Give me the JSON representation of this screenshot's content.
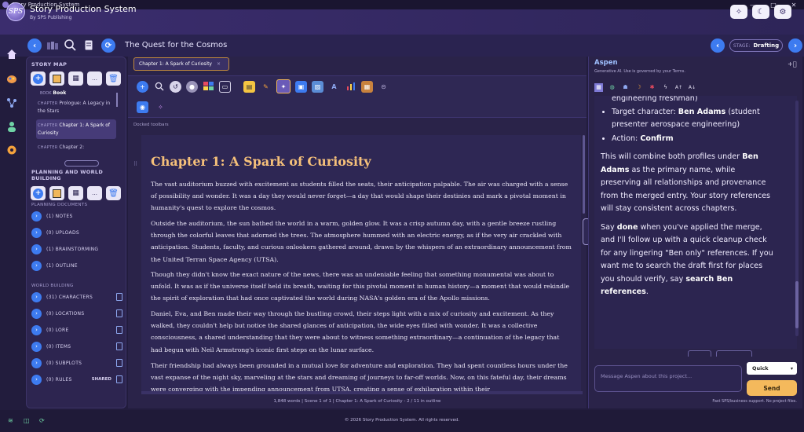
{
  "window": {
    "title": "Story Production System",
    "controls": [
      "—",
      "□",
      "✕"
    ]
  },
  "header": {
    "logo_text": "SPS",
    "title": "Story Production System",
    "subtitle": "By SPS Publishing"
  },
  "toolbar": {
    "story_title": "The Quest for the Cosmos",
    "stage_label": "STAGE:",
    "stage_value": "Drafting"
  },
  "sidebar": {
    "story_map_title": "STORY MAP",
    "book_kind": "BOOK",
    "book_name": "Book",
    "chapters": [
      {
        "kind": "CHAPTER",
        "name": "Prologue: A Legacy in the Stars"
      },
      {
        "kind": "CHAPTER",
        "name": "Chapter 1: A Spark of Curiosity"
      },
      {
        "kind": "CHAPTER",
        "name": "Chapter 2:"
      }
    ],
    "planning_title": "PLANNING AND WORLD BUILDING",
    "planning_docs_title": "PLANNING DOCUMENTS",
    "planning_docs": [
      {
        "label": "(1) NOTES"
      },
      {
        "label": "(0) UPLOADS"
      },
      {
        "label": "(1) BRAINSTORMING"
      },
      {
        "label": "(1) OUTLINE"
      }
    ],
    "world_title": "WORLD BUILDING",
    "world_items": [
      {
        "label": "(31) CHARACTERS"
      },
      {
        "label": "(0) LOCATIONS"
      },
      {
        "label": "(0) LORE"
      },
      {
        "label": "(0) ITEMS"
      },
      {
        "label": "(0) SUBPLOTS"
      },
      {
        "label": "(0) RULES",
        "badge": "SHARED"
      }
    ]
  },
  "editor": {
    "tab_label": "Chapter 1: A Spark of Curiosity",
    "tab_close": "×",
    "docked_label": "Docked toolbars",
    "chapter_title": "Chapter 1: A Spark of Curiosity",
    "paragraphs": [
      "The vast auditorium buzzed with excitement as students filled the seats, their anticipation palpable. The air was charged with a sense of possibility and wonder. It was a day they would never forget—a day that would shape their destinies and mark a pivotal moment in humanity's quest to explore the cosmos.",
      "Outside the auditorium, the sun bathed the world in a warm, golden glow. It was a crisp autumn day, with a gentle breeze rustling through the colorful leaves that adorned the trees. The atmosphere hummed with an electric energy, as if the very air crackled with anticipation. Students, faculty, and curious onlookers gathered around, drawn by the whispers of an extraordinary announcement from the United Terran Space Agency (UTSA).",
      "Though they didn't know the exact nature of the news, there was an undeniable feeling that something monumental was about to unfold. It was as if the universe itself held its breath, waiting for this pivotal moment in human history—a moment that would rekindle the spirit of exploration that had once captivated the world during NASA's golden era of the Apollo missions.",
      "Daniel, Eva, and Ben made their way through the bustling crowd, their steps light with a mix of curiosity and excitement. As they walked, they couldn't help but notice the shared glances of anticipation, the wide eyes filled with wonder. It was a collective consciousness, a shared understanding that they were about to witness something extraordinary—a continuation of the legacy that had begun with Neil Armstrong's iconic first steps on the lunar surface.",
      "Their friendship had always been grounded in a mutual love for adventure and exploration. They had spent countless hours under the vast expanse of the night sky, marveling at the stars and dreaming of journeys to far-off worlds. Now, on this fateful day, their dreams were converging with the impending announcement from UTSA, creating a sense of exhilaration within their"
    ],
    "status": "1,848 words | Scene 1 of 1 | Chapter 1: A Spark of Curiosity - 2 / 11 in outline"
  },
  "assistant": {
    "name": "Aspen",
    "disclaimer": "Generative AI. Use is governed by your Terms.",
    "top_fragment": "engineering freshman)",
    "bullet_target_label": "Target character:",
    "bullet_target_name": "Ben Adams",
    "bullet_target_desc": "(student presenter aerospace engineering)",
    "bullet_action_label": "Action:",
    "bullet_action_value": "Confirm",
    "p1_a": "This will combine both profiles under",
    "p1_name": "Ben Adams",
    "p1_b": "as the primary name, while preserving all relationships and provenance from the merged entry. Your story references will stay consistent across chapters.",
    "p2_a": "Say",
    "p2_done": "done",
    "p2_b": "when you've applied the merge, and I'll follow up with a quick cleanup check for any lingering \"Ben only\" references. If you want me to search the draft first for places you should verify, say",
    "p2_search": "search Ben references",
    "p2_end": ".",
    "input_placeholder": "Message Aspen about this project...",
    "mode": "Quick",
    "send_label": "Send",
    "send_note": "Fast SPS/business support. No project files."
  },
  "footer": {
    "copyright": "© 2026 Story Production System. All rights reserved."
  },
  "colors": {
    "accent_blue": "#3d7bf0",
    "accent_gold": "#f5c07a",
    "send": "#f4b95c",
    "bg": "#221c3d"
  }
}
